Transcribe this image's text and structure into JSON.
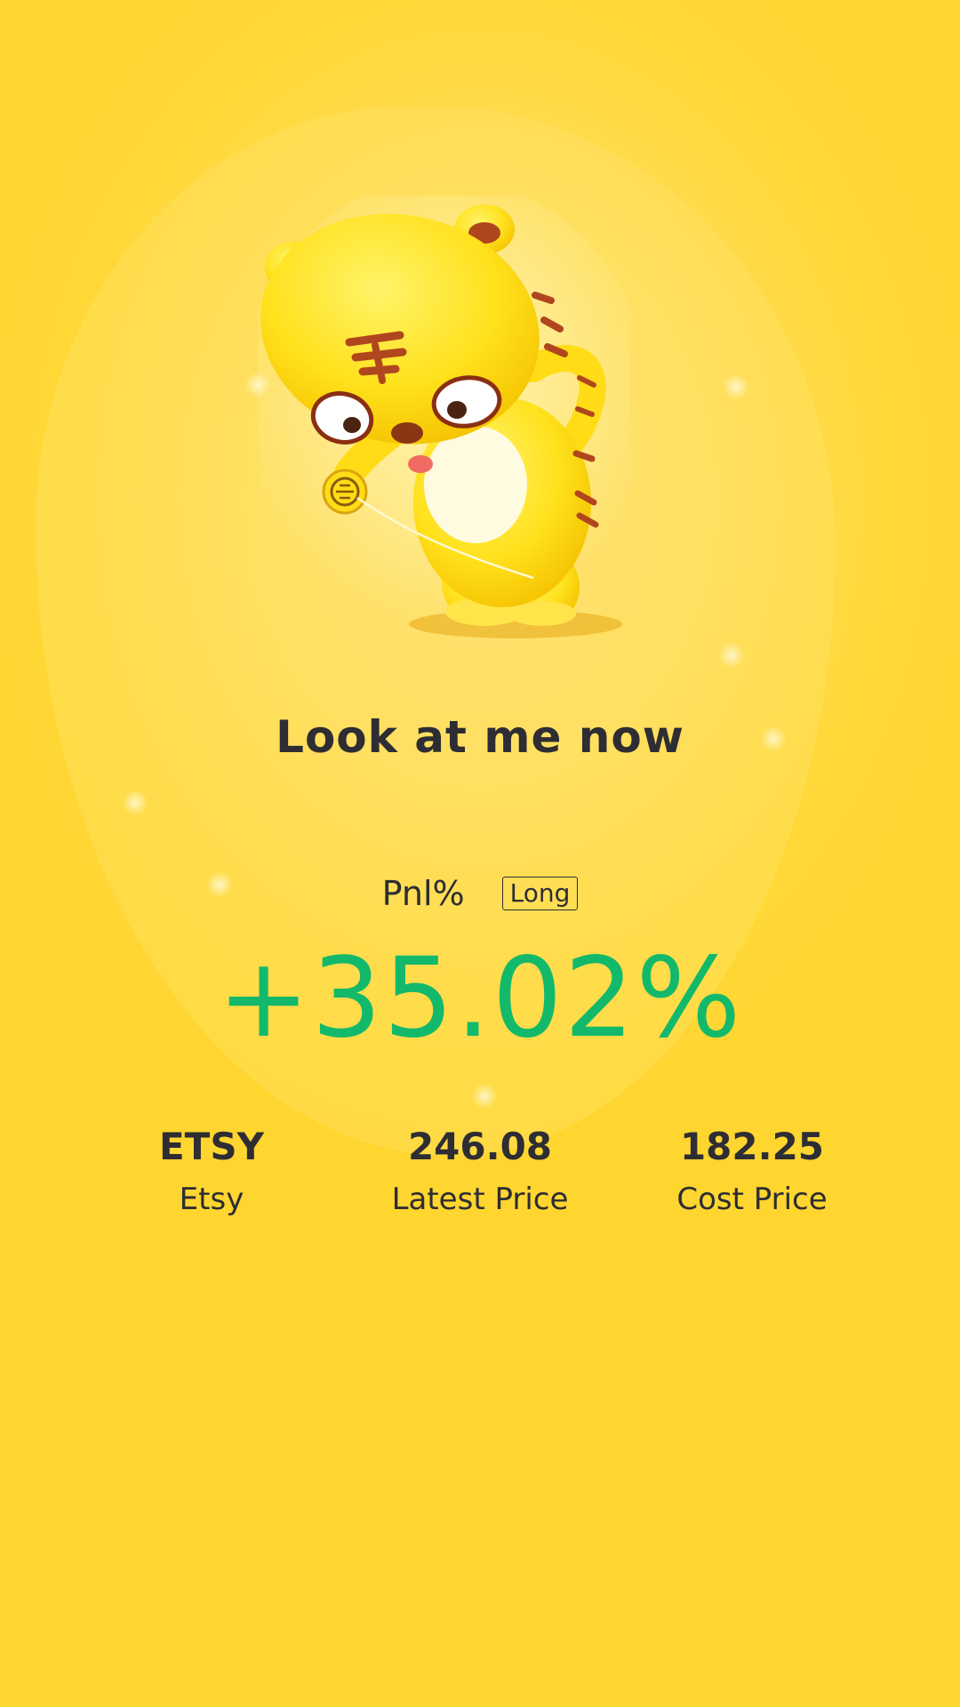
{
  "colors": {
    "background": "#ffd52f",
    "text": "#2d2d33",
    "profit_green": "#13b96b",
    "mascot_yellow": "#ffe01c",
    "mascot_stripes": "#b0461e"
  },
  "illustration": {
    "icon": "tiger-mascot-yoyo-icon"
  },
  "headline": "Look at me now",
  "pnl": {
    "label": "Pnl%",
    "direction_badge": "Long",
    "value": "+35.02%"
  },
  "stats": {
    "symbol": {
      "value": "ETSY",
      "label": "Etsy"
    },
    "latest_price": {
      "value": "246.08",
      "label": "Latest Price"
    },
    "cost_price": {
      "value": "182.25",
      "label": "Cost Price"
    }
  }
}
